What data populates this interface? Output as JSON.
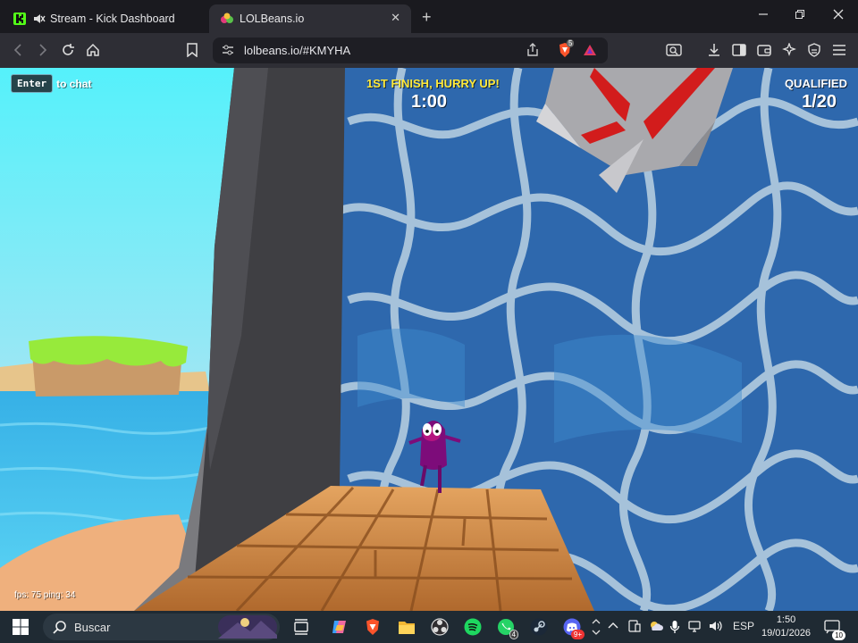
{
  "browser": {
    "tabs": [
      {
        "title": "Stream - Kick Dashboard",
        "close": "✕"
      },
      {
        "title": "LOLBeans.io",
        "close": "✕"
      }
    ],
    "new_tab": "+",
    "url": "lolbeans.io/#KMYHA",
    "brave_shield_count": "5"
  },
  "game": {
    "chat_key": "Enter",
    "chat_hint": "to chat",
    "finish_notice": "1ST FINISH, HURRY UP!",
    "timer": "1:00",
    "qualified_label": "QUALIFIED",
    "qualified_value": "1/20",
    "stats": "fps: 75 ping: 34"
  },
  "taskbar": {
    "search_placeholder": "Buscar",
    "whatsapp_badge": "4",
    "discord_badge": "9+",
    "language": "ESP",
    "time": "1:50",
    "date": "19/01/2026",
    "notifications": "10"
  },
  "colors": {
    "sky": "#5ee8f7",
    "water_wall": "#2f6fb4",
    "wood": "#c98a45",
    "hud_yellow": "#ffe93a",
    "taskbar": "#1f2a33"
  }
}
